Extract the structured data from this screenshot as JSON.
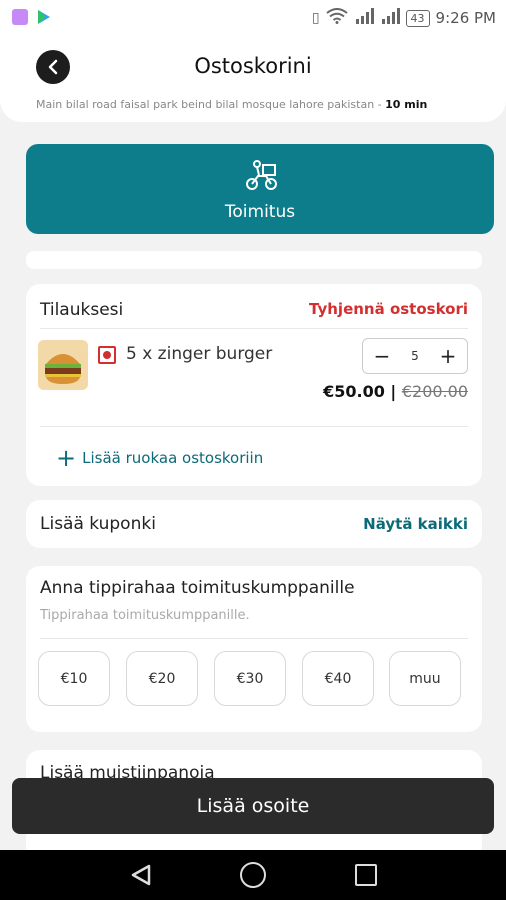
{
  "statusbar": {
    "time": "9:26 PM",
    "battery": "43",
    "signal1": "2G",
    "signal2": "H"
  },
  "header": {
    "title": "Ostoskorini",
    "address": "Main bilal road faisal park beind bilal mosque lahore pakistan",
    "separator": " - ",
    "eta": "10 min"
  },
  "delivery": {
    "label": "Toimitus"
  },
  "orders": {
    "title": "Tilauksesi",
    "clear_label": "Tyhjennä ostoskori",
    "item": {
      "name": "5 x zinger burger",
      "qty": "5",
      "minus": "−",
      "plus": "+",
      "price": "€50.00",
      "price_sep": " | ",
      "old_price": "€200.00"
    },
    "add_more_label": "Lisää ruokaa ostoskoriin"
  },
  "coupon": {
    "label": "Lisää kuponki",
    "see_all": "Näytä kaikki"
  },
  "tip": {
    "title": "Anna tippirahaa toimituskumppanille",
    "subtitle": "Tippirahaa toimituskumppanille.",
    "options": [
      "€10",
      "€20",
      "€30",
      "€40",
      "muu"
    ]
  },
  "notes": {
    "label": "Lisää muistiinpanoja"
  },
  "cta": {
    "label": "Lisää osoite"
  },
  "colors": {
    "accent": "#0d7d8c",
    "danger": "#d32f2f",
    "cta": "#2b2b2b"
  }
}
